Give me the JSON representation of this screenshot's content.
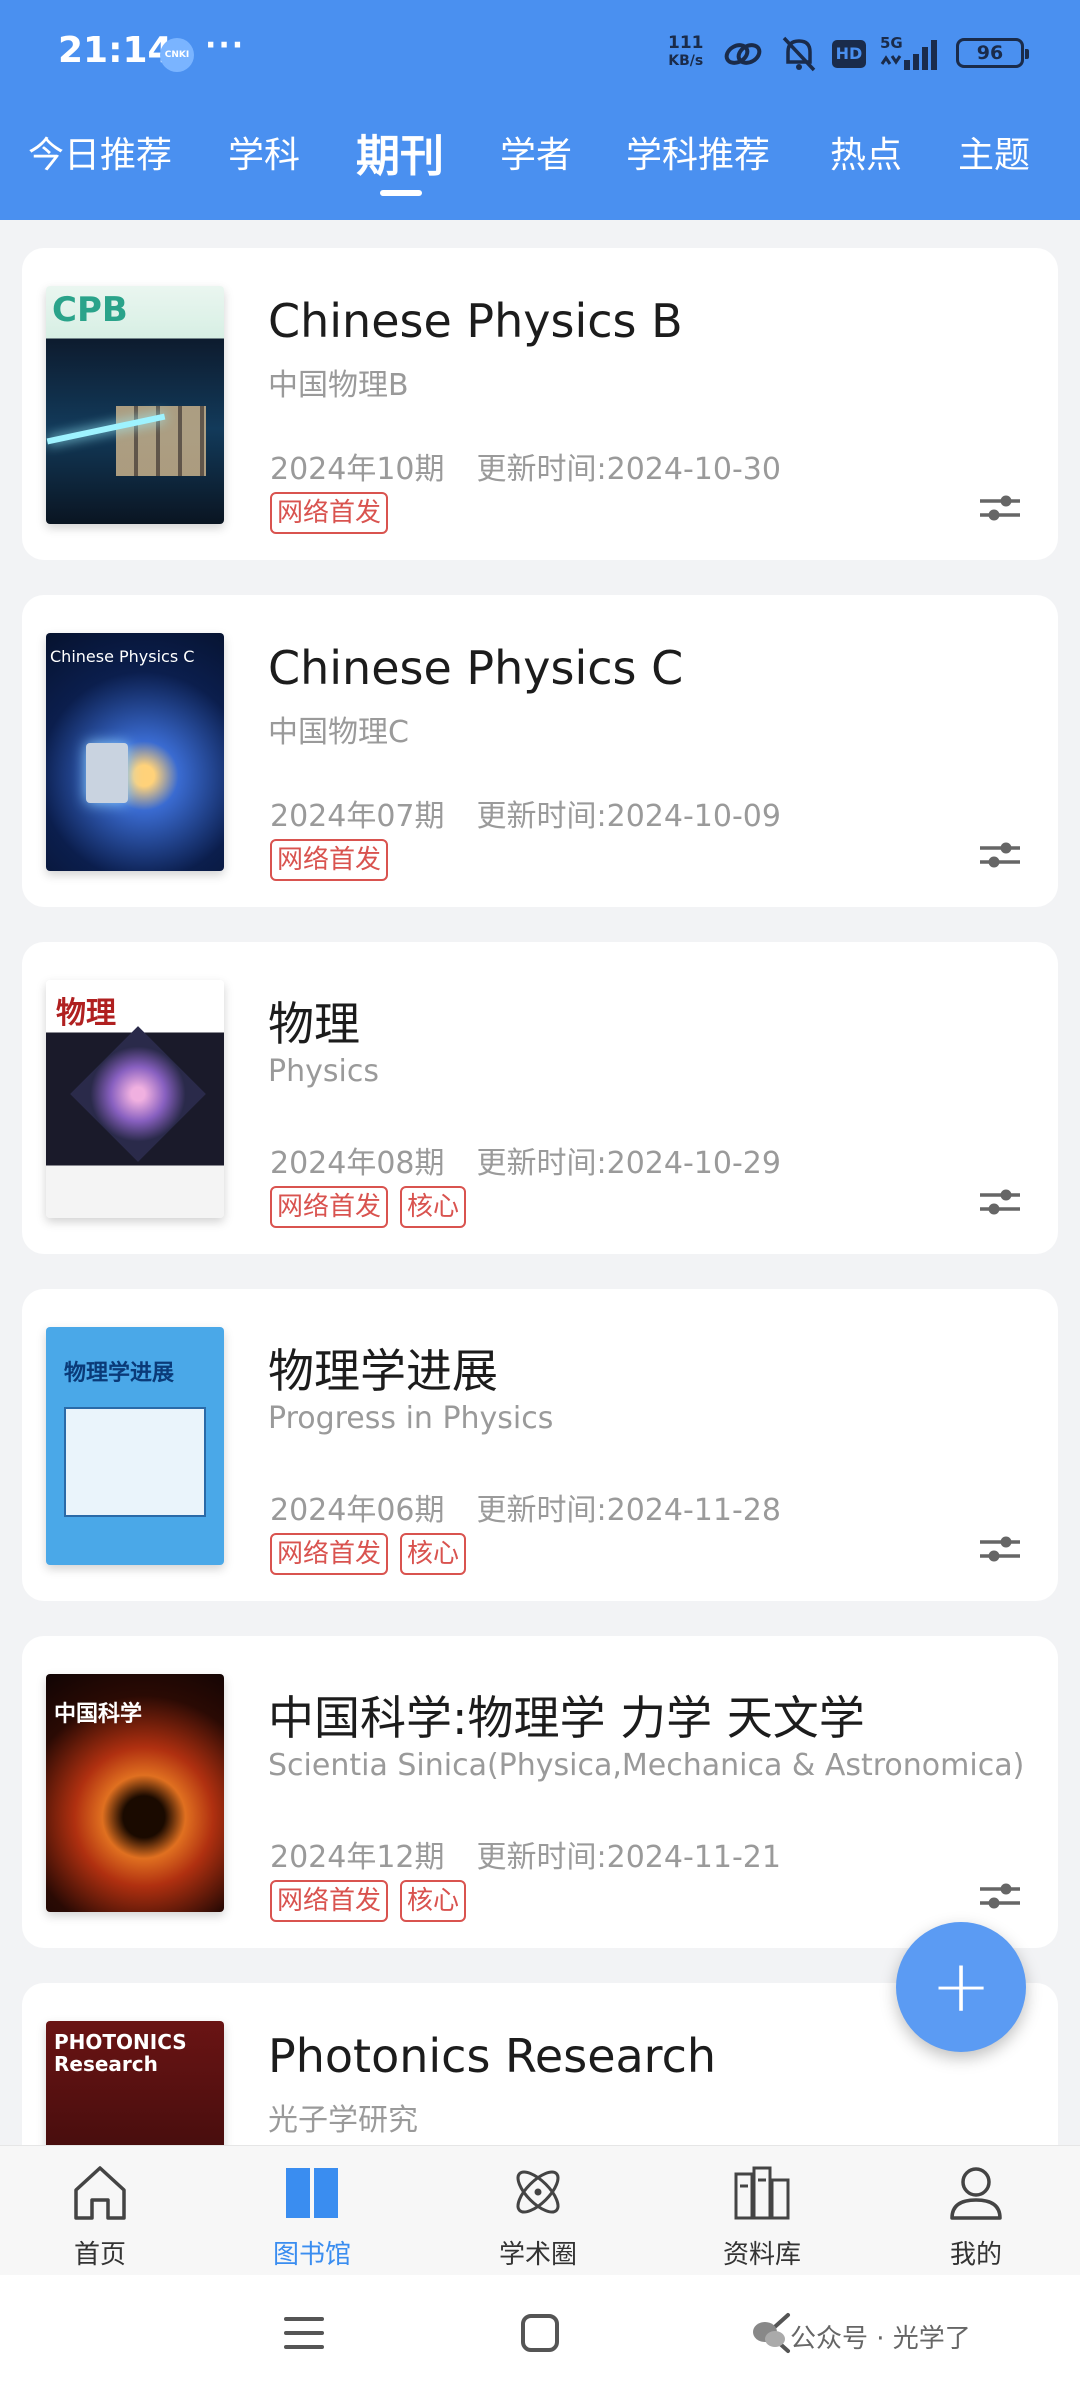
{
  "status_bar": {
    "time": "21:14",
    "app_icon": "CNKI",
    "dots": "···",
    "speed_value": "111",
    "speed_unit": "KB/s",
    "network": "5G",
    "battery": "96"
  },
  "tabs": [
    {
      "label": "今日推荐"
    },
    {
      "label": "学科"
    },
    {
      "label": "期刊"
    },
    {
      "label": "学者"
    },
    {
      "label": "学科推荐"
    },
    {
      "label": "热点"
    },
    {
      "label": "主题"
    }
  ],
  "active_tab": "期刊",
  "journals": [
    {
      "title": "Chinese Physics B",
      "subtitle": "中国物理B",
      "issue": "2024年10期",
      "updated": "更新时间:2024-10-30",
      "badges": [
        "网络首发"
      ],
      "cover_text": "CPB"
    },
    {
      "title": "Chinese Physics C",
      "subtitle": "中国物理C",
      "issue": "2024年07期",
      "updated": "更新时间:2024-10-09",
      "badges": [
        "网络首发"
      ],
      "cover_text": "Chinese Physics C"
    },
    {
      "title": "物理",
      "subtitle": "Physics",
      "issue": "2024年08期",
      "updated": "更新时间:2024-10-29",
      "badges": [
        "网络首发",
        "核心"
      ],
      "cover_text": "物理"
    },
    {
      "title": "物理学进展",
      "subtitle": "Progress in Physics",
      "issue": "2024年06期",
      "updated": "更新时间:2024-11-28",
      "badges": [
        "网络首发",
        "核心"
      ],
      "cover_text": "物理学进展"
    },
    {
      "title": "中国科学:物理学 力学 天文学",
      "subtitle": "Scientia Sinica(Physica,Mechanica & Astronomica)",
      "issue": "2024年12期",
      "updated": "更新时间:2024-11-21",
      "badges": [
        "网络首发",
        "核心"
      ],
      "cover_text": "中国科学"
    },
    {
      "title": "Photonics Research",
      "subtitle": "光子学研究",
      "issue": "",
      "updated": "",
      "badges": [],
      "cover_text": "PHOTONICS Research"
    }
  ],
  "fab_label": "+",
  "bottom_nav": [
    {
      "label": "首页",
      "icon": "home-icon"
    },
    {
      "label": "图书馆",
      "icon": "book-icon"
    },
    {
      "label": "学术圈",
      "icon": "atom-icon"
    },
    {
      "label": "资料库",
      "icon": "database-icon"
    },
    {
      "label": "我的",
      "icon": "profile-icon"
    }
  ],
  "active_nav": "图书馆",
  "watermark": "公众号 · 光学了",
  "colors": {
    "header_bg": "#4a90f0",
    "badge_red": "#d9534f",
    "nav_active": "#3a8df0"
  }
}
